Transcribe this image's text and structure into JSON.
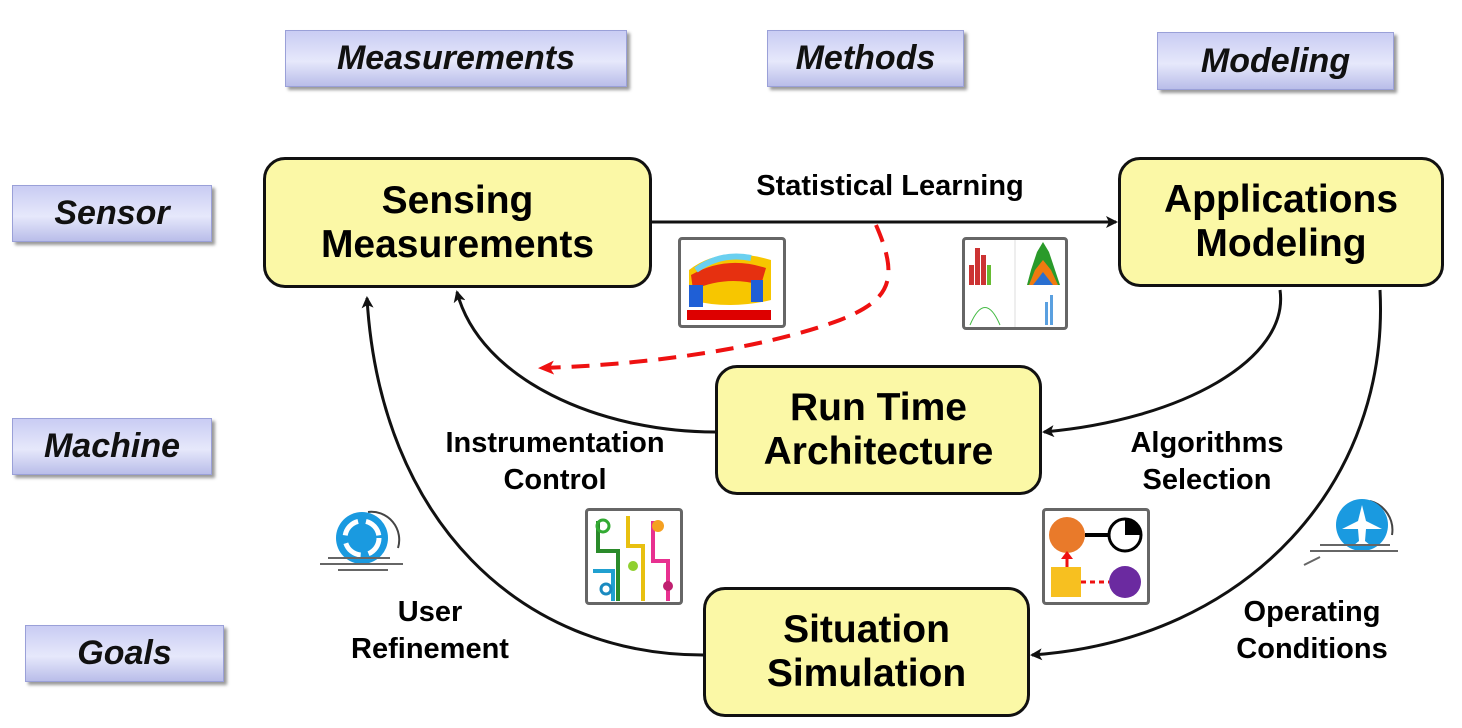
{
  "columns": [
    "Measurements",
    "Methods",
    "Modeling"
  ],
  "rows": [
    "Sensor",
    "Machine",
    "Goals"
  ],
  "nodes": {
    "sensing": [
      "Sensing",
      "Measurements"
    ],
    "applications": [
      "Applications",
      "Modeling"
    ],
    "runtime": [
      "Run Time",
      "Architecture"
    ],
    "situation": [
      "Situation",
      "Simulation"
    ]
  },
  "edges": {
    "statistical_learning": "Statistical Learning",
    "instrumentation": [
      "Instrumentation",
      "Control"
    ],
    "algorithms": [
      "Algorithms",
      "Selection"
    ],
    "user_refinement": [
      "User",
      "Refinement"
    ],
    "operating_conditions": [
      "Operating",
      "Conditions"
    ]
  },
  "colors": {
    "node_fill": "#fbf8a6",
    "header_fill": "#d8dbf7",
    "dashed_arrow": "#ee1111"
  },
  "icons": [
    "simulation-thumbnail",
    "histogram-thumbnail",
    "circuit-thumbnail",
    "graph-nodes-thumbnail",
    "recycle-icon",
    "airplane-icon"
  ]
}
